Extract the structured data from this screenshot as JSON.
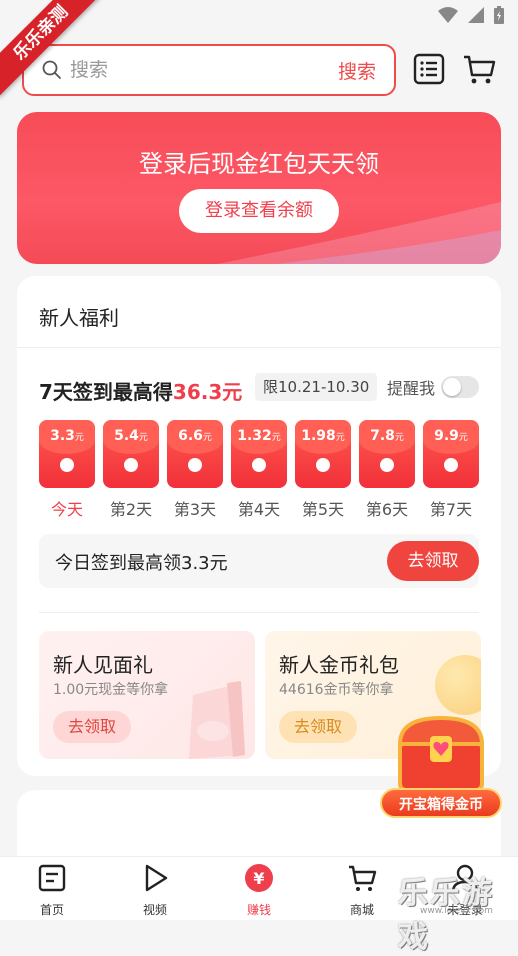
{
  "corner_ribbon": "乐乐亲测",
  "search": {
    "placeholder": "搜索",
    "button_label": "搜索"
  },
  "banner": {
    "title": "登录后现金红包天天领",
    "button_label": "登录查看余额"
  },
  "newbie": {
    "section_title": "新人福利",
    "checkin": {
      "title_prefix": "7天签到最高得",
      "title_amount": "36.3元",
      "date_badge": "限10.21-10.30",
      "remind_label": "提醒我",
      "remind_on": false,
      "days": [
        {
          "value": "3.3",
          "unit": "元",
          "label": "今天"
        },
        {
          "value": "5.4",
          "unit": "元",
          "label": "第2天"
        },
        {
          "value": "6.6",
          "unit": "元",
          "label": "第3天"
        },
        {
          "value": "1.32",
          "unit": "元",
          "label": "第4天"
        },
        {
          "value": "1.98",
          "unit": "元",
          "label": "第5天"
        },
        {
          "value": "7.8",
          "unit": "元",
          "label": "第6天"
        },
        {
          "value": "9.9",
          "unit": "元",
          "label": "第7天"
        }
      ],
      "claim_text": "今日签到最高领3.3元",
      "claim_button": "去领取"
    },
    "gifts": [
      {
        "title": "新人见面礼",
        "subtitle": "1.00元现金等你拿",
        "button": "去领取"
      },
      {
        "title": "新人金币礼包",
        "subtitle": "44616金币等你拿",
        "button": "去领取"
      }
    ]
  },
  "treasure": {
    "label": "开宝箱得金币"
  },
  "bottom_nav": [
    {
      "label": "首页"
    },
    {
      "label": "视频"
    },
    {
      "label": "赚钱",
      "active": true,
      "badge": "¥"
    },
    {
      "label": "商城"
    },
    {
      "label": "未登录"
    }
  ],
  "watermark": {
    "text": "乐乐游戏",
    "url": "www.leleyx.com"
  },
  "colors": {
    "accent": "#f03f4c",
    "banner": "#fd5866",
    "background": "#f5f5f5"
  }
}
